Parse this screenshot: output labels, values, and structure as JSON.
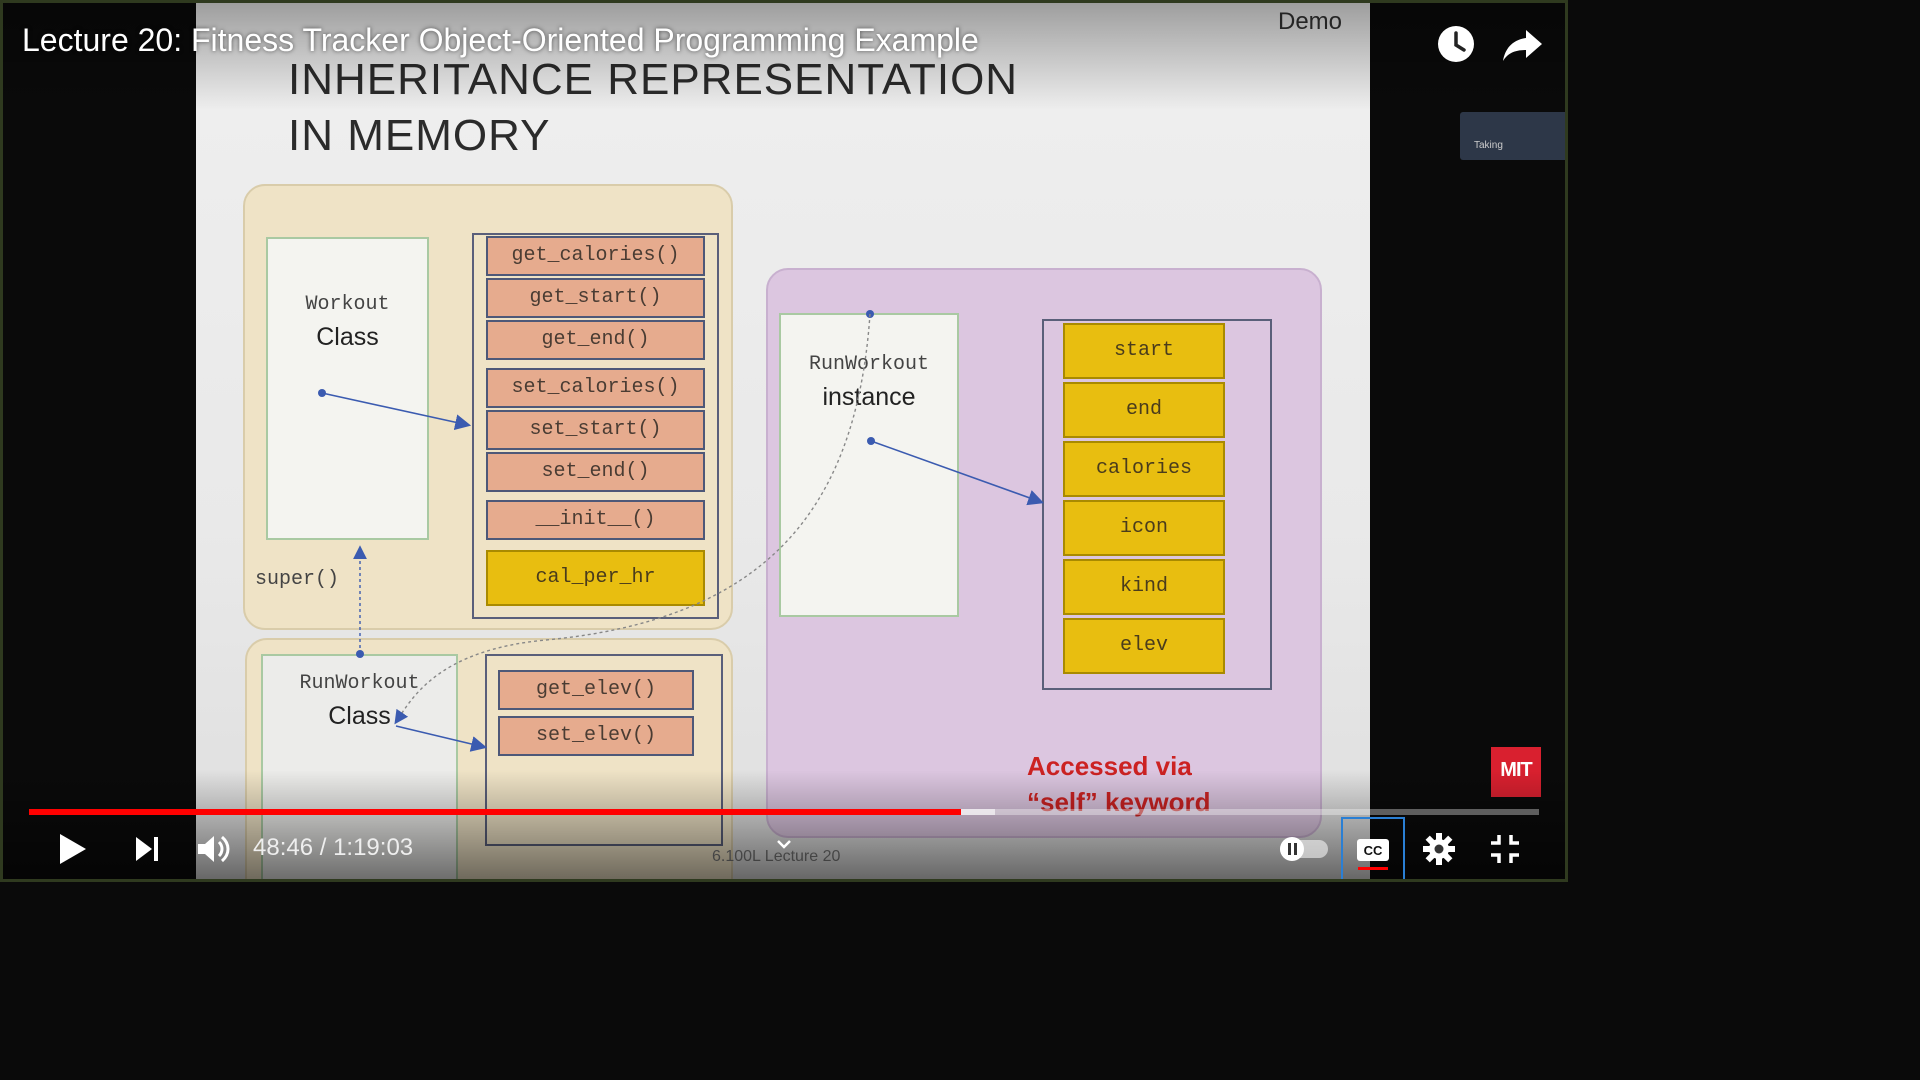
{
  "player": {
    "title": "Lecture 20: Fitness Tracker Object-Oriented Programming Example",
    "current_time": "48:46",
    "duration": "1:19:03",
    "time_display": "48:46 / 1:19:03",
    "progress_fraction": 0.617,
    "buffered_fraction": 0.64,
    "icons": {
      "watch_later": "clock-icon",
      "share": "share-arrow-icon",
      "play": "play-icon",
      "next": "next-icon",
      "volume": "volume-icon",
      "chevron": "chevron-down-icon",
      "autoplay": "autoplay-toggle-icon",
      "captions": "cc-icon",
      "settings": "gear-icon",
      "exit_fullscreen": "exit-fullscreen-icon"
    },
    "colors": {
      "progress": "#ff0000",
      "captions_underline": "#ff0000",
      "focus": "#2a7fd4"
    },
    "channel_logo_text": "MIT",
    "mini_thumb_text": "Taking"
  },
  "slide": {
    "demo_label": "Demo",
    "title_line1": "INHERITANCE REPRESENTATION",
    "title_line2": "IN MEMORY",
    "workout_class": {
      "name": "Workout",
      "kind": "Class"
    },
    "workout_methods": [
      "get_calories()",
      "get_start()",
      "get_end()",
      "set_calories()",
      "set_start()",
      "set_end()",
      "__init__()"
    ],
    "workout_attr": "cal_per_hr",
    "super_label": "super()",
    "runworkout_class": {
      "name": "RunWorkout",
      "kind": "Class"
    },
    "runworkout_methods": [
      "get_elev()",
      "set_elev()"
    ],
    "instance": {
      "name": "RunWorkout",
      "kind": "instance"
    },
    "instance_attrs": [
      "start",
      "end",
      "calories",
      "icon",
      "kind",
      "elev"
    ],
    "accessed_line1": "Accessed via",
    "accessed_line2": "“self” keyword",
    "footer": "6.100L Lecture 20",
    "colors": {
      "method_fill": "#e6ab8e",
      "attr_fill": "#e8be10",
      "arrow": "#3b5bb0",
      "accent_text": "#cc2222"
    }
  }
}
